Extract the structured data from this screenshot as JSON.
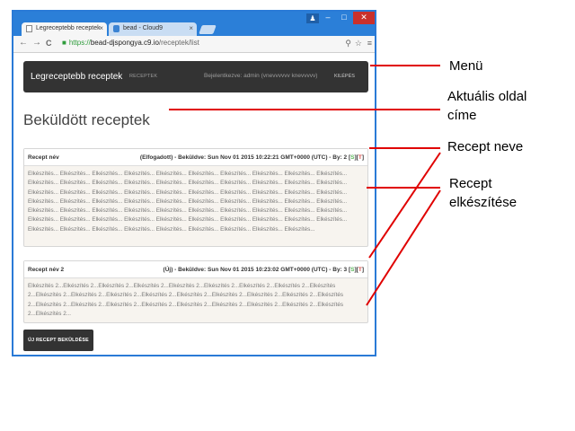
{
  "browser": {
    "tabs": [
      {
        "label": "Legreceptebb receptek",
        "close": "×"
      },
      {
        "label": "bead - Cloud9",
        "close": "×"
      }
    ],
    "window_controls": {
      "user": "♟",
      "minimize": "–",
      "maximize": "□",
      "close": "✕"
    },
    "address": {
      "scheme": "https://",
      "host": "bead-djspongya.c9.io",
      "path": "/receptek/list"
    },
    "nav": {
      "back": "←",
      "forward": "→",
      "reload": "C"
    },
    "toolbar_icons": {
      "key": "⚲",
      "star": "☆",
      "menu": "≡"
    }
  },
  "navbar": {
    "brand": "Legreceptebb receptek",
    "link": "RECEPTEK",
    "user_text": "Bejelentkezve: admin (vnevvvvvv knevvvvv)",
    "logout": "KILÉPÉS"
  },
  "page": {
    "title": "Beküldött receptek",
    "recipes": [
      {
        "name": "Recept név",
        "meta": "(Elfogadott) - Beküldve: Sun Nov 01 2015 10:22:21 GMT+0000 (UTC) - By: 2 ",
        "s": "S",
        "t": "T",
        "body": "Elkészítés... Elkészítés... Elkészítés... Elkészítés... Elkészítés... Elkészítés... Elkészítés... Elkészítés... Elkészítés... Elkészítés... Elkészítés... Elkészítés... Elkészítés... Elkészítés... Elkészítés... Elkészítés... Elkészítés... Elkészítés... Elkészítés... Elkészítés... Elkészítés... Elkészítés... Elkészítés... Elkészítés... Elkészítés... Elkészítés... Elkészítés... Elkészítés... Elkészítés... Elkészítés... Elkészítés... Elkészítés... Elkészítés... Elkészítés... Elkészítés... Elkészítés... Elkészítés... Elkészítés... Elkészítés... Elkészítés... Elkészítés... Elkészítés... Elkészítés... Elkészítés... Elkészítés... Elkészítés... Elkészítés... Elkészítés... Elkészítés... Elkészítés... Elkészítés... Elkészítés... Elkészítés... Elkészítés... Elkészítés... Elkészítés... Elkészítés... Elkészítés... Elkészítés... Elkészítés... Elkészítés... Elkészítés... Elkészítés... Elkészítés... Elkészítés... Elkészítés... Elkészítés... Elkészítés... Elkészítés..."
      },
      {
        "name": "Recept név 2",
        "meta": "(Új) - Beküldve: Sun Nov 01 2015 10:23:02 GMT+0000 (UTC) - By: 3 ",
        "s": "S",
        "t": "T",
        "body": "Elkészítés 2...Elkészítés 2...Elkészítés 2...Elkészítés 2...Elkészítés 2...Elkészítés 2...Elkészítés 2...Elkészítés 2...Elkészítés 2...Elkészítés 2...Elkészítés 2...Elkészítés 2...Elkészítés 2...Elkészítés 2...Elkészítés 2...Elkészítés 2...Elkészítés 2...Elkészítés 2...Elkészítés 2...Elkészítés 2...Elkészítés 2...Elkészítés 2...Elkészítés 2...Elkészítés 2...Elkészítés 2...Elkészítés 2...Elkészítés 2...Elkészítés 2..."
      }
    ],
    "submit_button": "ÚJ RECEPT BEKÜLDÉSE"
  },
  "annotations": {
    "menu": "Menü",
    "title_l1": "Aktuális oldal",
    "title_l2": "címe",
    "name": "Recept neve",
    "prep_l1": "Recept",
    "prep_l2": "elkészítése",
    "line_color": "#e00000"
  }
}
